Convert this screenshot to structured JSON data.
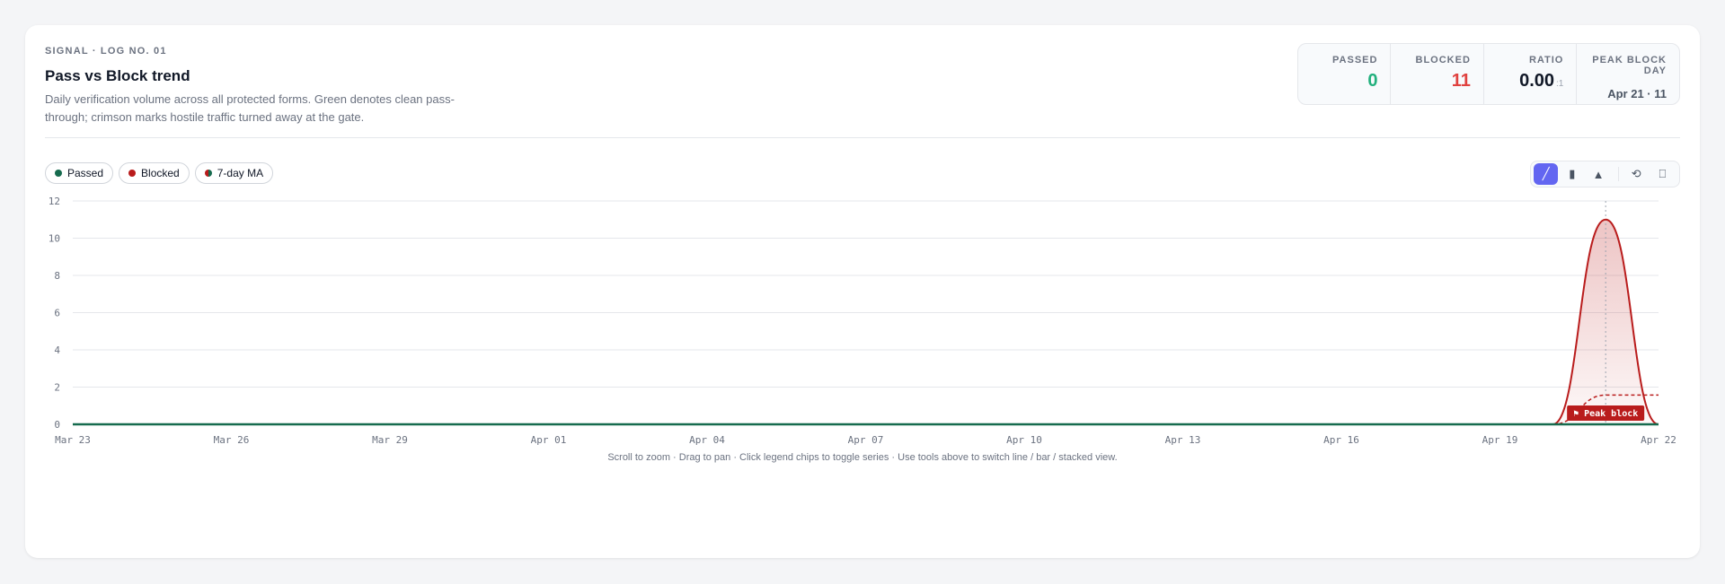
{
  "header": {
    "eyebrow": "SIGNAL · LOG NO. 01",
    "title": "Pass vs Block trend",
    "subtitle": "Daily verification volume across all protected forms. Green denotes clean pass-through; crimson marks hostile traffic turned away at the gate."
  },
  "stats": {
    "passed_label": "PASSED",
    "passed_value": "0",
    "blocked_label": "BLOCKED",
    "blocked_value": "11",
    "ratio_label": "RATIO",
    "ratio_value": "0.00",
    "ratio_suffix": ":1",
    "peak_label": "PEAK BLOCK DAY",
    "peak_value": "Apr 21 · 11"
  },
  "legend": {
    "passed": "Passed",
    "blocked": "Blocked",
    "ma": "7-day MA"
  },
  "tools": {
    "line": "╱",
    "bar": "▮",
    "stacked": "▲",
    "reset": "⟲",
    "export": "⎕"
  },
  "hint": "Scroll to zoom · Drag to pan · Click legend chips to toggle series · Use tools above to switch line / bar / stacked view.",
  "colors": {
    "passed": "#166b4e",
    "blocked": "#b91c1c",
    "accent": "#6366f1",
    "passed_stat": "#22b07d",
    "blocked_stat": "#e0413f"
  },
  "chart_data": {
    "type": "line",
    "x": [
      "Mar 23",
      "Mar 24",
      "Mar 25",
      "Mar 26",
      "Mar 27",
      "Mar 28",
      "Mar 29",
      "Mar 30",
      "Mar 31",
      "Apr 01",
      "Apr 02",
      "Apr 03",
      "Apr 04",
      "Apr 05",
      "Apr 06",
      "Apr 07",
      "Apr 08",
      "Apr 09",
      "Apr 10",
      "Apr 11",
      "Apr 12",
      "Apr 13",
      "Apr 14",
      "Apr 15",
      "Apr 16",
      "Apr 17",
      "Apr 18",
      "Apr 19",
      "Apr 20",
      "Apr 21",
      "Apr 22"
    ],
    "x_ticks": [
      "Mar 23",
      "Mar 26",
      "Mar 29",
      "Apr 01",
      "Apr 04",
      "Apr 07",
      "Apr 10",
      "Apr 13",
      "Apr 16",
      "Apr 19",
      "Apr 22"
    ],
    "y_ticks": [
      "0",
      "2",
      "4",
      "6",
      "8",
      "10",
      "12"
    ],
    "ylim": [
      0,
      12
    ],
    "series": [
      {
        "name": "Passed",
        "values": [
          0,
          0,
          0,
          0,
          0,
          0,
          0,
          0,
          0,
          0,
          0,
          0,
          0,
          0,
          0,
          0,
          0,
          0,
          0,
          0,
          0,
          0,
          0,
          0,
          0,
          0,
          0,
          0,
          0,
          0,
          0
        ]
      },
      {
        "name": "Blocked",
        "values": [
          0,
          0,
          0,
          0,
          0,
          0,
          0,
          0,
          0,
          0,
          0,
          0,
          0,
          0,
          0,
          0,
          0,
          0,
          0,
          0,
          0,
          0,
          0,
          0,
          0,
          0,
          0,
          0,
          0,
          11,
          0
        ]
      },
      {
        "name": "7-day MA",
        "values": [
          0,
          0,
          0,
          0,
          0,
          0,
          0,
          0,
          0,
          0,
          0,
          0,
          0,
          0,
          0,
          0,
          0,
          0,
          0,
          0,
          0,
          0,
          0,
          0,
          0,
          0,
          0,
          0,
          0,
          1.57,
          1.57
        ]
      }
    ],
    "annotation": {
      "x": "Apr 21",
      "label": "⚑ Peak block"
    },
    "grid": true,
    "legend": "top-left"
  }
}
